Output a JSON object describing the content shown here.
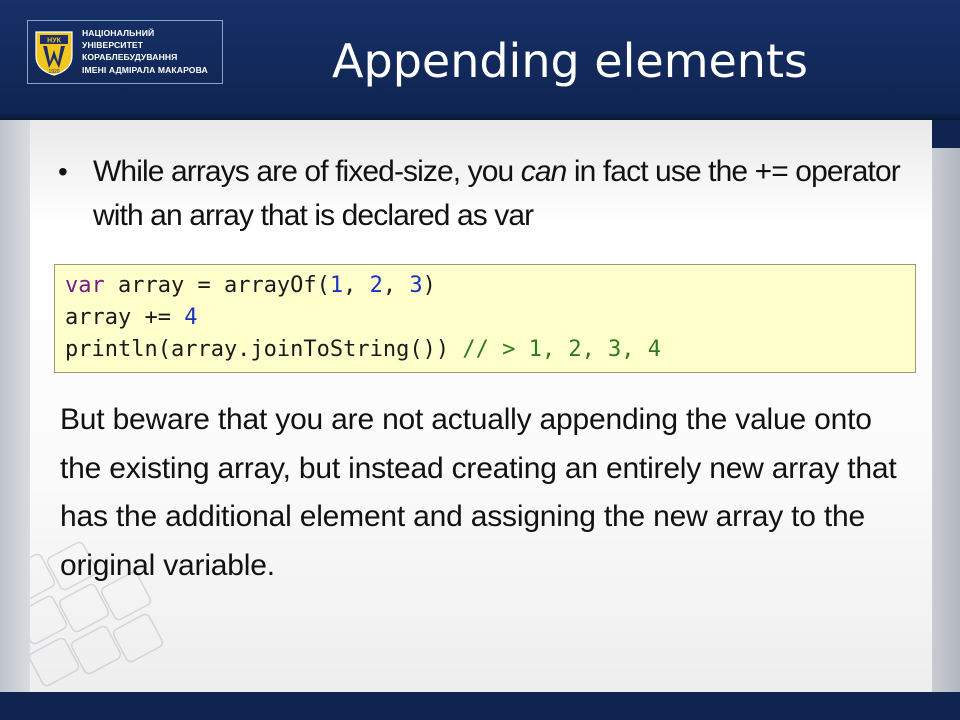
{
  "header": {
    "logo": {
      "lines": [
        "НАЦІОНАЛЬНИЙ",
        "УНІВЕРСИТЕТ",
        "КОРАБЛЕБУДУВАННЯ",
        "ІМЕНІ АДМІРАЛА МАКАРОВА"
      ],
      "emblem_text": "НУК",
      "emblem_year": "1920"
    },
    "title": "Appending elements"
  },
  "bullet": {
    "text_before": "While arrays are of fixed-size, you ",
    "emphasis": "can",
    "text_after": " in fact use the += operator with an array that is declared as var"
  },
  "code": {
    "line1": {
      "kw": "var",
      "rest1": " array = arrayOf(",
      "n1": "1",
      "sep1": ", ",
      "n2": "2",
      "sep2": ", ",
      "n3": "3",
      "end": ")"
    },
    "line2": {
      "text": "array += ",
      "n": "4"
    },
    "line3": {
      "text": "println(array.joinToString()) ",
      "comment": "// > 1, 2, 3, 4"
    }
  },
  "paragraph": "But beware that you are not actually appending the value onto the existing array, but instead creating an entirely new array that has the additional element and assigning the new array to the original variable.",
  "colors": {
    "header_bg": "#0f2450",
    "code_bg": "#ffffcc",
    "keyword": "#7a1a8a",
    "number": "#1a30c0",
    "comment": "#2f7a1f"
  }
}
